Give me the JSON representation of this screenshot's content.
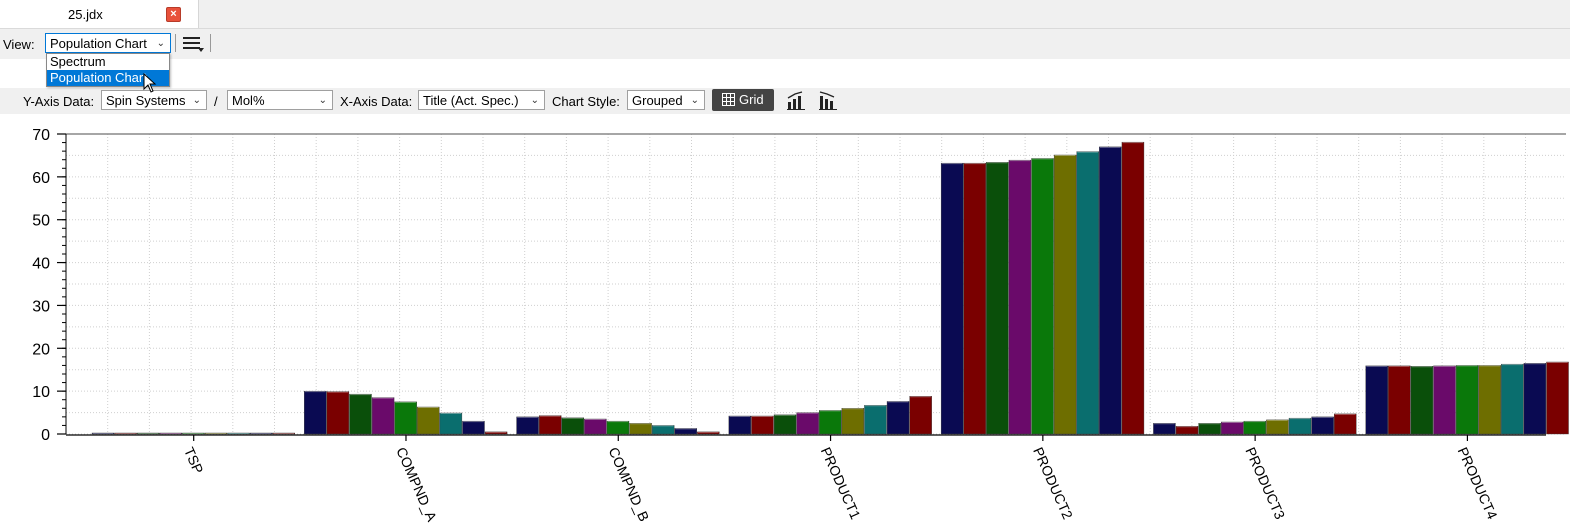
{
  "tab": {
    "title": "25.jdx",
    "close_glyph": "×"
  },
  "view": {
    "label": "View:",
    "selected": "Population Chart",
    "options": [
      "Spectrum",
      "Population Chart"
    ]
  },
  "toolbar": {
    "y_axis_label": "Y-Axis Data:",
    "y_axis_value": "Spin Systems",
    "divider": "/",
    "y_unit_value": "Mol%",
    "x_axis_label": "X-Axis Data:",
    "x_axis_value": "Title (Act. Spec.)",
    "chart_style_label": "Chart Style:",
    "chart_style_value": "Grouped",
    "grid_button_label": "Grid",
    "icons": [
      "menu-icon",
      "grid-icon",
      "bar-chart-up-icon",
      "bar-chart-down-icon"
    ]
  },
  "colors": {
    "series": [
      "#0a0a52",
      "#7a0000",
      "#0a4f0a",
      "#6a0a6a",
      "#0a780a",
      "#6e6e00",
      "#0a6e6e",
      "#0a0a52",
      "#7a0000"
    ],
    "grid_button_bg": "#444444",
    "selection": "#0078d7"
  },
  "chart_data": {
    "type": "bar",
    "style": "grouped",
    "grid": true,
    "ylim": [
      0,
      70
    ],
    "yticks": [
      "0",
      "10",
      "20",
      "30",
      "40",
      "50",
      "60",
      "70"
    ],
    "categories": [
      "TSP",
      "COMPND_A",
      "COMPND_B",
      "PRODUCT1",
      "PRODUCT2",
      "PRODUCT3",
      "PRODUCT4"
    ],
    "series": [
      {
        "values": [
          0.1,
          10.0,
          4.0,
          4.2,
          63.2,
          2.5,
          15.9
        ]
      },
      {
        "values": [
          0.1,
          9.9,
          4.3,
          4.2,
          63.2,
          1.8,
          15.9
        ]
      },
      {
        "values": [
          0.1,
          9.3,
          3.8,
          4.5,
          63.4,
          2.5,
          15.8
        ]
      },
      {
        "values": [
          0.1,
          8.5,
          3.5,
          5.0,
          63.9,
          2.8,
          15.9
        ]
      },
      {
        "values": [
          0.1,
          7.5,
          3.0,
          5.5,
          64.3,
          3.0,
          16.0
        ]
      },
      {
        "values": [
          0.1,
          6.3,
          2.5,
          6.0,
          65.1,
          3.3,
          16.0
        ]
      },
      {
        "values": [
          0.1,
          4.9,
          2.0,
          6.7,
          65.9,
          3.7,
          16.3
        ]
      },
      {
        "values": [
          0.1,
          3.0,
          1.3,
          7.6,
          67.0,
          4.0,
          16.5
        ]
      },
      {
        "values": [
          0.1,
          0.5,
          0.5,
          8.8,
          68.1,
          4.7,
          16.8
        ]
      }
    ]
  }
}
